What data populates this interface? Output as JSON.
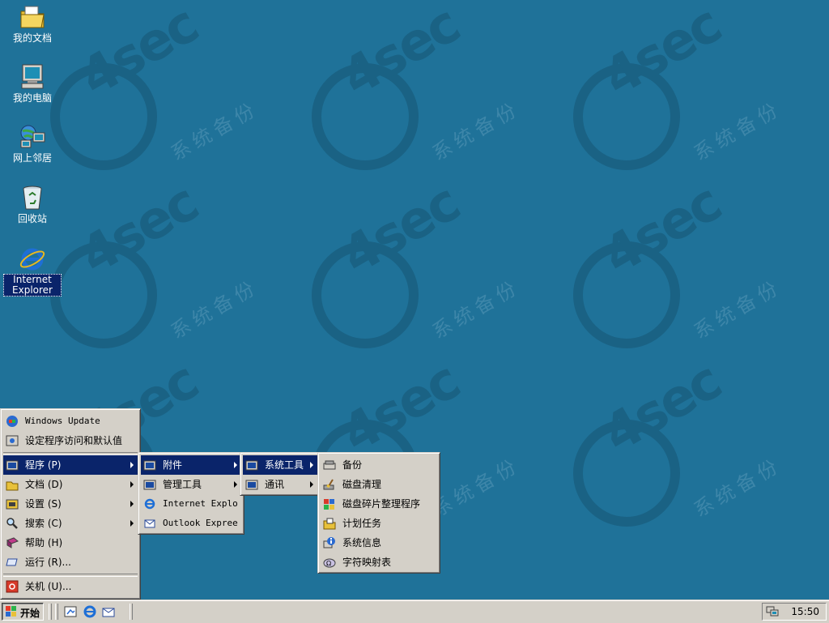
{
  "desktop": {
    "watermark": {
      "logo": "4sec",
      "text": "系统备份"
    },
    "icons": [
      {
        "label": "我的文档",
        "icon": "my-documents-icon"
      },
      {
        "label": "我的电脑",
        "icon": "my-computer-icon"
      },
      {
        "label": "网上邻居",
        "icon": "network-places-icon"
      },
      {
        "label": "回收站",
        "icon": "recycle-bin-icon"
      },
      {
        "label": "Internet Explorer",
        "icon": "internet-explorer-icon"
      }
    ]
  },
  "start_menu": {
    "items": [
      {
        "label": "Windows Update",
        "icon": "windows-update-icon"
      },
      {
        "label": "设定程序访问和默认值",
        "icon": "program-defaults-icon"
      },
      {
        "label": "程序 (P)",
        "icon": "programs-icon"
      },
      {
        "label": "文档 (D)",
        "icon": "documents-icon"
      },
      {
        "label": "设置 (S)",
        "icon": "settings-icon"
      },
      {
        "label": "搜索 (C)",
        "icon": "search-icon"
      },
      {
        "label": "帮助 (H)",
        "icon": "help-icon"
      },
      {
        "label": "运行 (R)...",
        "icon": "run-icon"
      },
      {
        "label": "关机 (U)...",
        "icon": "shutdown-icon"
      }
    ]
  },
  "programs_menu": {
    "items": [
      {
        "label": "附件",
        "icon": "program-group-icon"
      },
      {
        "label": "管理工具",
        "icon": "program-group-icon"
      },
      {
        "label": "Internet Explo",
        "icon": "internet-explorer-icon"
      },
      {
        "label": "Outlook Expree",
        "icon": "outlook-express-icon"
      }
    ]
  },
  "accessories_menu": {
    "items": [
      {
        "label": "系统工具",
        "icon": "program-group-icon"
      },
      {
        "label": "通讯",
        "icon": "program-group-icon"
      }
    ]
  },
  "system_tools_menu": {
    "items": [
      {
        "label": "备份",
        "icon": "backup-icon"
      },
      {
        "label": "磁盘清理",
        "icon": "disk-cleanup-icon"
      },
      {
        "label": "磁盘碎片整理程序",
        "icon": "defragmenter-icon"
      },
      {
        "label": "计划任务",
        "icon": "scheduled-tasks-icon"
      },
      {
        "label": "系统信息",
        "icon": "system-info-icon"
      },
      {
        "label": "字符映射表",
        "icon": "character-map-icon"
      }
    ]
  },
  "taskbar": {
    "start_label": "开始",
    "quick_launch": [
      "show-desktop-icon",
      "internet-explorer-icon",
      "outlook-express-icon"
    ],
    "tray": {
      "icon": "network-tray-icon",
      "clock": "15:50"
    }
  }
}
